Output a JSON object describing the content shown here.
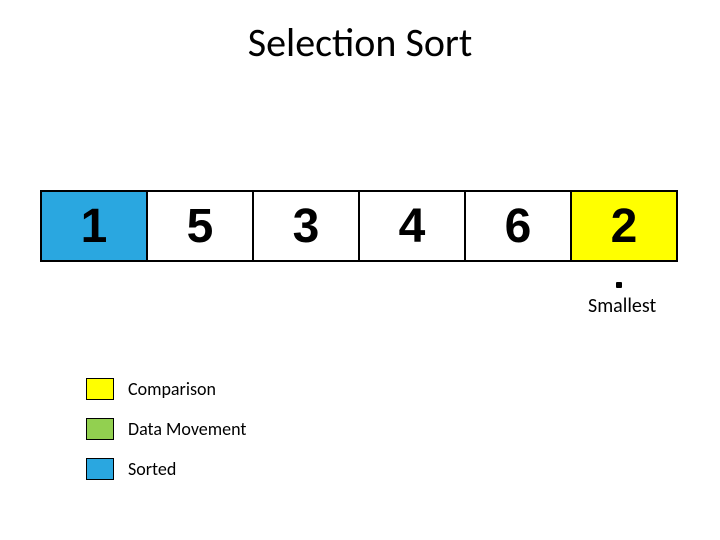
{
  "title": "Selection Sort",
  "cells": [
    {
      "value": "1",
      "bg": "#2aa7e0"
    },
    {
      "value": "5",
      "bg": "#ffffff"
    },
    {
      "value": "3",
      "bg": "#ffffff"
    },
    {
      "value": "4",
      "bg": "#ffffff"
    },
    {
      "value": "6",
      "bg": "#ffffff"
    },
    {
      "value": "2",
      "bg": "#ffff00"
    }
  ],
  "smallest_label": "Smallest",
  "legend": [
    {
      "label": "Comparison",
      "color": "#ffff00"
    },
    {
      "label": "Data Movement",
      "color": "#92d050"
    },
    {
      "label": "Sorted",
      "color": "#2aa7e0"
    }
  ]
}
